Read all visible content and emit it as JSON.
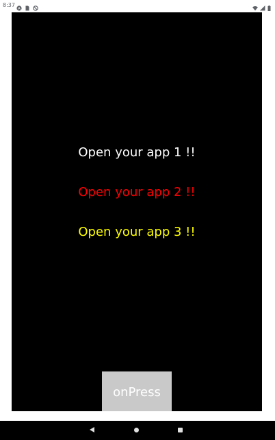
{
  "status_bar": {
    "time": "8:37",
    "left_icons": [
      "a-circle-icon",
      "sim-card-icon",
      "circle-slash-icon"
    ],
    "right_icons": [
      "wifi-icon",
      "signal-icon",
      "battery-icon"
    ]
  },
  "colors": {
    "app_background": "#000000",
    "message_1": "#ffffff",
    "message_2": "#ff0000",
    "message_3": "#ffff00",
    "button_background": "#c9c9c9",
    "button_text": "#ffffff"
  },
  "messages": [
    "Open your app 1 !!",
    "Open your app 2 !!",
    "Open your app 3 !!"
  ],
  "button": {
    "label": "onPress"
  },
  "nav_bar": {
    "buttons": [
      "back-icon",
      "home-icon",
      "recents-icon"
    ]
  }
}
